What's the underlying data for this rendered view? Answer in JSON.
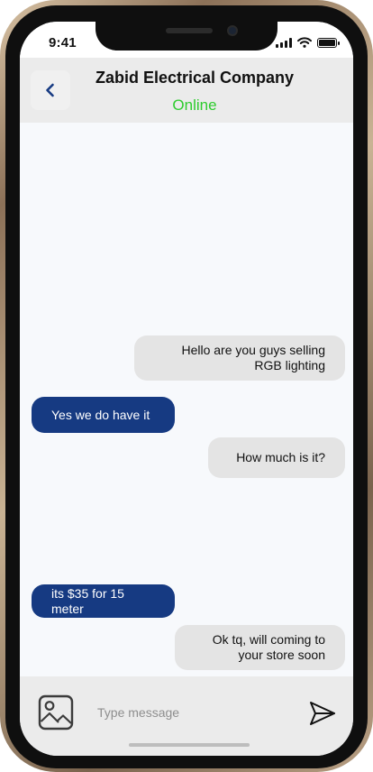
{
  "status_bar": {
    "time": "9:41"
  },
  "header": {
    "back_icon": "chevron-left-icon",
    "contact_name": "Zabid Electrical Company",
    "contact_status": "Online",
    "status_color": "#2ecc2e"
  },
  "messages": [
    {
      "direction": "sent",
      "text": "Hello are you guys selling RGB lighting"
    },
    {
      "direction": "received",
      "text": "Yes we do have it"
    },
    {
      "direction": "sent",
      "text": "How much is it?"
    },
    {
      "direction": "received",
      "text": "its $35 for 15 meter"
    },
    {
      "direction": "sent",
      "text": "Ok tq, will coming to your store soon"
    }
  ],
  "input_bar": {
    "image_icon": "image-icon",
    "placeholder": "Type message",
    "value": "",
    "send_icon": "send-icon"
  },
  "colors": {
    "sent_bubble": "#e4e4e4",
    "received_bubble": "#163a82",
    "header_bg": "#ebebeb",
    "accent": "#163a82"
  }
}
